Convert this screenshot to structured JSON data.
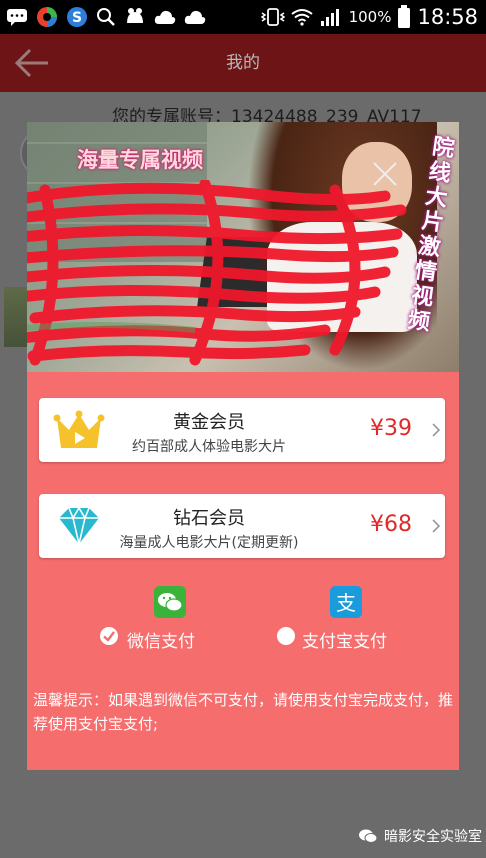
{
  "status_bar": {
    "battery": "100%",
    "time": "18:58",
    "icons": [
      "chat-icon",
      "colorful-app-icon",
      "s-app-icon",
      "search-icon",
      "animal-app-icon",
      "cloud-icon",
      "cloud-icon",
      "vibrate-icon",
      "wifi-icon",
      "signal-icon",
      "battery-icon"
    ]
  },
  "app_bar": {
    "title": "我的",
    "back_icon": "back-arrow-icon"
  },
  "background": {
    "account_line": "您的专属账号：13424488_239_AV117"
  },
  "banner": {
    "text_left": "海量专属视频",
    "text_right": "院线大片激情视频",
    "close_icon": "close-icon"
  },
  "plans": [
    {
      "name": "黄金会员",
      "desc": "约百部成人体验电影大片",
      "price": "¥39",
      "icon": "crown-icon"
    },
    {
      "name": "钻石会员",
      "desc": "海量成人电影大片(定期更新)",
      "price": "¥68",
      "icon": "diamond-icon"
    }
  ],
  "payment": {
    "wechat_label": "微信支付",
    "alipay_label": "支付宝支付",
    "selected": "wechat"
  },
  "notice": "温馨提示：如果遇到微信不可支付，请使用支付宝完成支付，推荐使用支付宝支付;",
  "watermark": "暗影安全实验室",
  "colors": {
    "popup": "#f56d6d",
    "appbar": "#6c1416",
    "price": "#e02a2a",
    "gold": "#f6c22b",
    "diamond": "#29b9cf",
    "wechat": "#3bb33b",
    "alipay": "#1a9bdc"
  }
}
